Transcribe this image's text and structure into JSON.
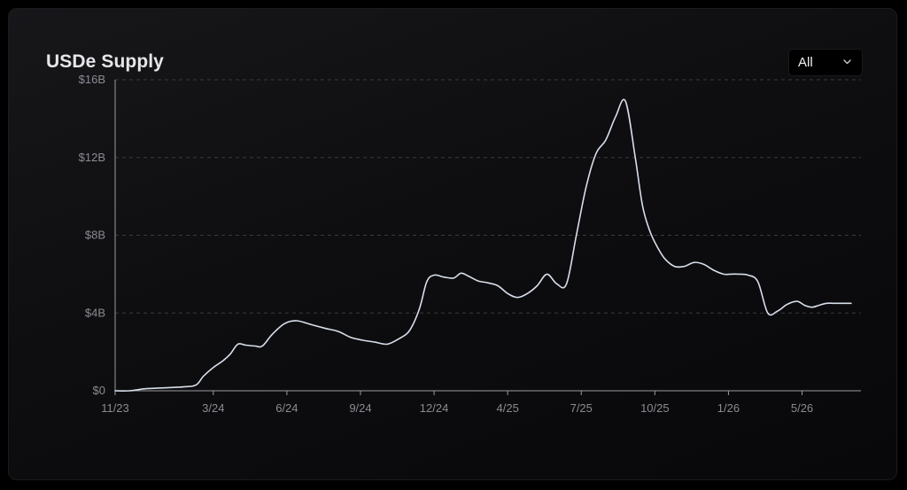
{
  "window": {
    "title": "USDe Supply"
  },
  "range_select": {
    "value": "All",
    "icon": "chevron-down-icon"
  },
  "colors": {
    "line": "#d7deeb",
    "grid": "#3a3a3f",
    "axis": "#9a9aa2",
    "label": "#8a8a93",
    "title": "#e6e6ea"
  },
  "chart_data": {
    "type": "line",
    "title": "USDe Supply",
    "xlabel": "",
    "ylabel": "",
    "x_unit": "months since 11/23",
    "xlim": [
      0,
      30.4
    ],
    "ylim": [
      0,
      16
    ],
    "y_ticks": [
      0,
      4,
      8,
      12,
      16
    ],
    "y_tick_labels": [
      "$0",
      "$4B",
      "$8B",
      "$12B",
      "$16B"
    ],
    "x_ticks": [
      0,
      4,
      7,
      10,
      13,
      16,
      19,
      22,
      25,
      28
    ],
    "x_tick_labels": [
      "11/23",
      "3/24",
      "6/24",
      "9/24",
      "12/24",
      "4/25",
      "7/25",
      "10/25",
      "1/26",
      "5/26"
    ],
    "grid": "horizontal dashed",
    "series": [
      {
        "name": "USDe Supply",
        "unit": "$B",
        "x": [
          0,
          0.6,
          1.2,
          2.0,
          2.8,
          3.3,
          3.6,
          4.0,
          4.4,
          4.7,
          5.0,
          5.3,
          5.7,
          6.0,
          6.4,
          6.9,
          7.4,
          8.0,
          8.6,
          9.1,
          9.6,
          10.1,
          10.6,
          11.1,
          11.6,
          12.0,
          12.4,
          12.7,
          13.0,
          13.4,
          13.8,
          14.1,
          14.4,
          14.8,
          15.2,
          15.6,
          16.0,
          16.4,
          16.8,
          17.2,
          17.6,
          18.0,
          18.4,
          18.8,
          19.2,
          19.6,
          20.0,
          20.4,
          20.8,
          21.2,
          21.5,
          21.8,
          22.1,
          22.4,
          22.8,
          23.2,
          23.6,
          24.0,
          24.4,
          24.8,
          25.1,
          25.4,
          25.8,
          26.2,
          26.6,
          27.0,
          27.4,
          27.8,
          28.1,
          28.4,
          28.7,
          29.0,
          29.3,
          29.6,
          30.0
        ],
        "y": [
          0.0,
          0.0,
          0.1,
          0.15,
          0.2,
          0.3,
          0.75,
          1.2,
          1.55,
          1.9,
          2.4,
          2.35,
          2.3,
          2.3,
          2.9,
          3.45,
          3.6,
          3.4,
          3.2,
          3.05,
          2.75,
          2.6,
          2.5,
          2.4,
          2.7,
          3.1,
          4.2,
          5.6,
          5.95,
          5.85,
          5.8,
          6.05,
          5.9,
          5.65,
          5.55,
          5.4,
          5.0,
          4.8,
          5.0,
          5.4,
          6.0,
          5.5,
          5.5,
          8.0,
          10.5,
          12.2,
          12.9,
          14.1,
          14.9,
          12.0,
          9.5,
          8.2,
          7.4,
          6.8,
          6.4,
          6.4,
          6.6,
          6.5,
          6.2,
          6.0,
          6.0,
          6.0,
          5.95,
          5.6,
          4.0,
          4.1,
          4.45,
          4.6,
          4.4,
          4.3,
          4.4,
          4.5,
          4.5,
          4.5,
          4.5
        ]
      }
    ]
  }
}
